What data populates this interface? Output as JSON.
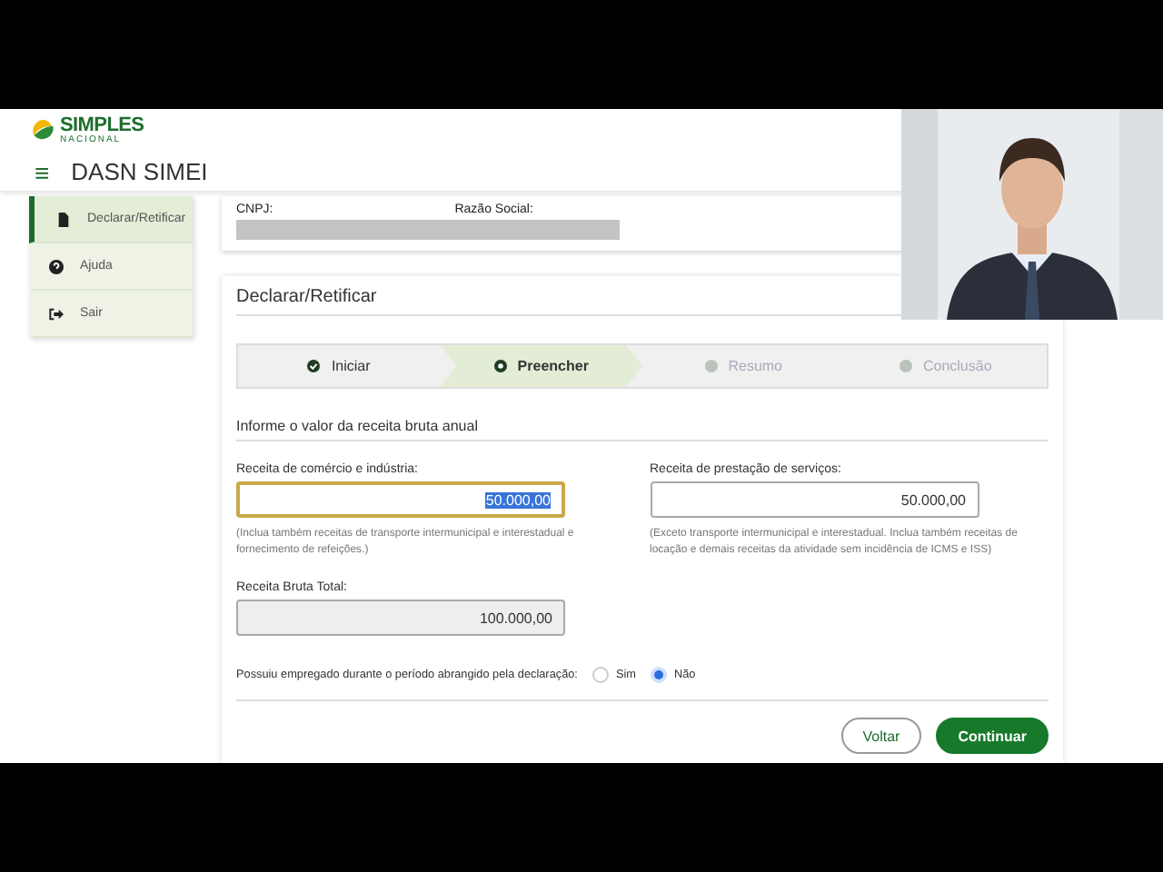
{
  "logo": {
    "name": "SIMPLES",
    "sub": "NACIONAL"
  },
  "header": {
    "menu_glyph": "≡",
    "title": "DASN SIMEI"
  },
  "sidebar": {
    "items": [
      {
        "label": "Declarar/Retificar",
        "selected": true
      },
      {
        "label": "Ajuda",
        "selected": false
      },
      {
        "label": "Sair",
        "selected": false
      }
    ]
  },
  "company": {
    "cnpj_label": "CNPJ:",
    "name_label": "Razão Social:"
  },
  "form": {
    "title": "Declarar/Retificar",
    "steps": [
      {
        "label": "Iniciar",
        "completed": true,
        "selected": false
      },
      {
        "label": "Preencher",
        "completed": false,
        "selected": true
      },
      {
        "label": "Resumo",
        "completed": false,
        "selected": false
      },
      {
        "label": "Conclusão",
        "completed": false,
        "selected": false
      }
    ],
    "section_title": "Informe o valor da receita bruta anual",
    "fields": [
      {
        "label": "Receita de comércio e indústria:",
        "value": "50.000,00",
        "focused": true,
        "disabled": false,
        "help": "(Inclua também receitas de transporte intermunicipal e interestadual e fornecimento de refeições.)"
      },
      {
        "label": "Receita de prestação de serviços:",
        "value": "50.000,00",
        "focused": false,
        "disabled": false,
        "help": "(Exceto transporte intermunicipal e interestadual. Inclua também receitas de locação e demais receitas da atividade sem incidência de ICMS e ISS)"
      }
    ],
    "total": {
      "label": "Receita Bruta Total:",
      "value": "100.000,00",
      "disabled": true
    },
    "question": "Possuiu empregado durante o período abrangido pela declaração:",
    "options": [
      {
        "label": "Sim",
        "selected": false
      },
      {
        "label": "Não",
        "selected": true
      }
    ],
    "buttons": [
      {
        "label": "Voltar",
        "kind": "secondary"
      },
      {
        "label": "Continuar",
        "kind": "primary"
      }
    ]
  }
}
